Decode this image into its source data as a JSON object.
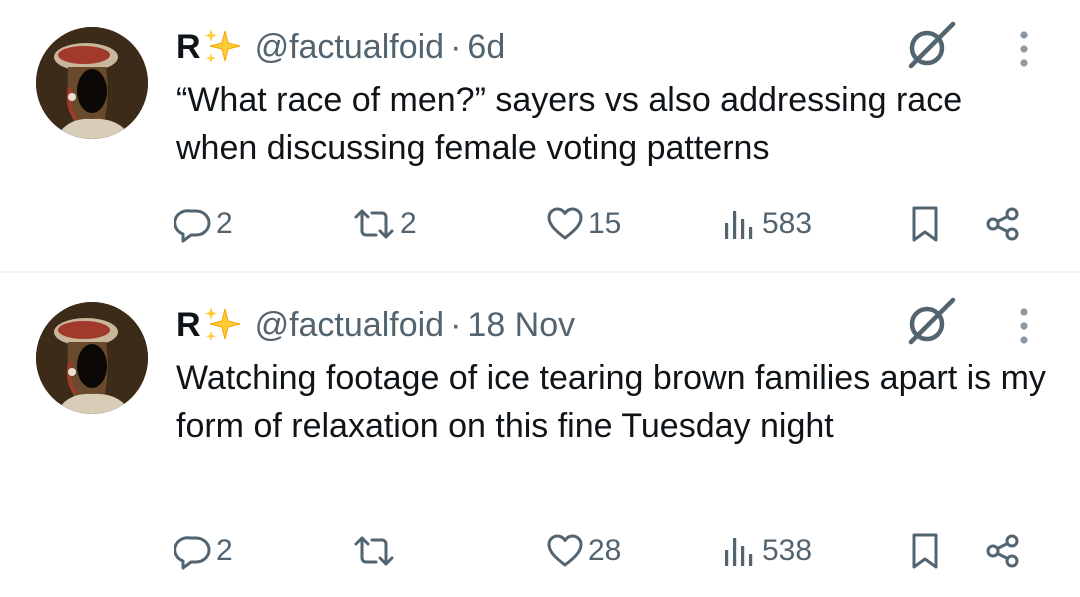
{
  "tweets": [
    {
      "author": {
        "name": "R",
        "badge_icon": "sparkles-emoji",
        "handle": "@factualfoid"
      },
      "separator": "·",
      "time": "6d",
      "text": "“What race of men?” sayers vs also addressing race when discussing female voting patterns",
      "stats": {
        "replies": "2",
        "retweets": "2",
        "likes": "15",
        "views": "583"
      }
    },
    {
      "author": {
        "name": "R",
        "badge_icon": "sparkles-emoji",
        "handle": "@factualfoid"
      },
      "separator": "·",
      "time": "18 Nov",
      "text": "Watching footage of ice tearing brown families apart is my form of relaxation on this fine Tuesday night",
      "stats": {
        "replies": "2",
        "retweets": "",
        "likes": "28",
        "views": "538"
      }
    }
  ],
  "colors": {
    "text": "#0f1419",
    "muted": "#536471",
    "divider": "#eff3f4",
    "background": "#ffffff"
  },
  "icons": [
    "grok-icon",
    "more-vertical-icon",
    "reply-icon",
    "retweet-icon",
    "like-icon",
    "views-icon",
    "bookmark-icon",
    "share-icon"
  ]
}
